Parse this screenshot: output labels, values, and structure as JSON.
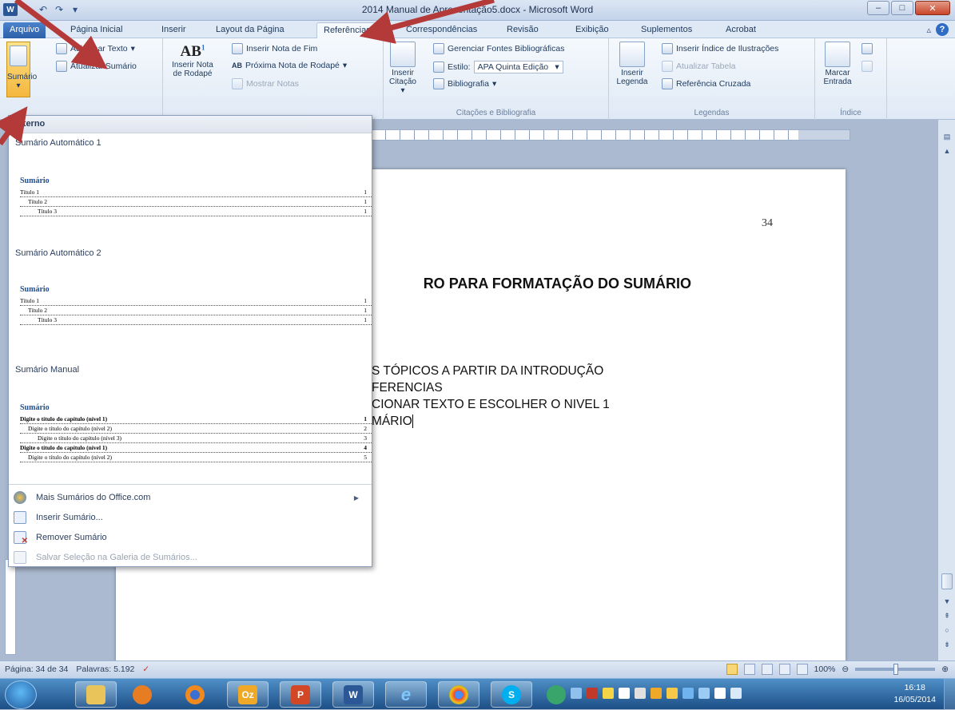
{
  "window": {
    "title": "2014 Manual de Apresentação5.docx - Microsoft Word",
    "logo": "W",
    "controls": [
      "minimize-icon",
      "maximize-icon",
      "close-icon"
    ]
  },
  "tabs": [
    {
      "label": "Arquivo",
      "id": "file"
    },
    {
      "label": "Página Inicial",
      "id": "home"
    },
    {
      "label": "Inserir",
      "id": "insert"
    },
    {
      "label": "Layout da Página",
      "id": "layout"
    },
    {
      "label": "Referências",
      "id": "references",
      "active": true
    },
    {
      "label": "Correspondências",
      "id": "mailings"
    },
    {
      "label": "Revisão",
      "id": "review"
    },
    {
      "label": "Exibição",
      "id": "view"
    },
    {
      "label": "Suplementos",
      "id": "addins"
    },
    {
      "label": "Acrobat",
      "id": "acrobat"
    }
  ],
  "ribbon": {
    "toc": {
      "sumario": "Sumário",
      "adicionar_texto": "Adicionar Texto",
      "atualizar_sumario": "Atualizar Sumário"
    },
    "footnotes": {
      "inserir_nota_line1": "Inserir Nota",
      "inserir_nota_line2": "de Rodapé",
      "inserir_nota_fim": "Inserir Nota de Fim",
      "proxima_nota": "Próxima Nota de Rodapé",
      "mostrar_notas": "Mostrar Notas"
    },
    "citations": {
      "inserir_citacao_line1": "Inserir",
      "inserir_citacao_line2": "Citação",
      "gerenciar_fontes": "Gerenciar Fontes Bibliográficas",
      "estilo_label": "Estilo:",
      "estilo_value": "APA Quinta Edição",
      "bibliografia": "Bibliografia",
      "group_label": "Citações e Bibliografia"
    },
    "captions": {
      "inserir_legenda_line1": "Inserir",
      "inserir_legenda_line2": "Legenda",
      "inserir_indice_ilustracoes": "Inserir Índice de Ilustrações",
      "atualizar_tabela": "Atualizar Tabela",
      "referencia_cruzada": "Referência Cruzada",
      "group_label": "Legendas"
    },
    "index": {
      "marcar_entrada_line1": "Marcar",
      "marcar_entrada_line2": "Entrada",
      "group_label": "Índice"
    }
  },
  "menu": {
    "header": "Interno",
    "gallery": [
      {
        "title": "Sumário Automático 1",
        "thumb_title": "Sumário",
        "rows": [
          {
            "text": "Título 1",
            "num": "1"
          },
          {
            "text": "Título 2",
            "num": "1"
          },
          {
            "text": "Título 3",
            "num": "1"
          }
        ]
      },
      {
        "title": "Sumário Automático 2",
        "thumb_title": "Sumário",
        "rows": [
          {
            "text": "Título 1",
            "num": "1"
          },
          {
            "text": "Título 2",
            "num": "1"
          },
          {
            "text": "Título 3",
            "num": "1"
          }
        ]
      },
      {
        "title": "Sumário Manual",
        "thumb_title": "Sumário",
        "rows": [
          {
            "text": "Digite o título do capítulo (nível 1)",
            "num": "1"
          },
          {
            "text": "Digite o título do capítulo (nível 2)",
            "num": "2"
          },
          {
            "text": "Digite o título do capítulo (nível 3)",
            "num": "3"
          },
          {
            "text": "Digite o título do capítulo (nível 1)",
            "num": "4"
          },
          {
            "text": "Digite o título do capítulo (nível 2)",
            "num": "5"
          }
        ]
      }
    ],
    "actions": [
      {
        "label": "Mais Sumários do Office.com",
        "has_submenu": true,
        "disabled": false
      },
      {
        "label": "Inserir Sumário...",
        "has_submenu": false,
        "disabled": false
      },
      {
        "label": "Remover Sumário",
        "has_submenu": false,
        "disabled": false
      },
      {
        "label": "Salvar Seleção na Galeria de Sumários...",
        "has_submenu": false,
        "disabled": true
      }
    ]
  },
  "document": {
    "page_number": "34",
    "heading": "RO PARA FORMATAÇÃO DO SUMÁRIO",
    "lines": [
      "S TÓPICOS A PARTIR DA INTRODUÇÃO",
      "FERENCIAS",
      "CIONAR TEXTO E ESCOLHER O NIVEL 1",
      "MÁRIO"
    ]
  },
  "statusbar": {
    "page": "Página: 34 de 34",
    "words": "Palavras: 5.192",
    "zoom": "100%"
  },
  "taskbar": {
    "clock_time": "16:18",
    "clock_date": "16/05/2014",
    "apps": [
      {
        "name": "explorer",
        "label": ""
      },
      {
        "name": "media",
        "label": ""
      },
      {
        "name": "firefox",
        "label": ""
      },
      {
        "name": "outlook",
        "label": "Oz"
      },
      {
        "name": "powerpoint",
        "label": "P"
      },
      {
        "name": "word",
        "label": "W"
      },
      {
        "name": "ie",
        "label": "e"
      },
      {
        "name": "chrome",
        "label": ""
      },
      {
        "name": "skype",
        "label": "S"
      },
      {
        "name": "other",
        "label": ""
      }
    ]
  },
  "colors": {
    "accent_arrow": "#b43a3a",
    "ribbon_bg": "#dfe9f5",
    "file_tab": "#2c5fa8"
  }
}
